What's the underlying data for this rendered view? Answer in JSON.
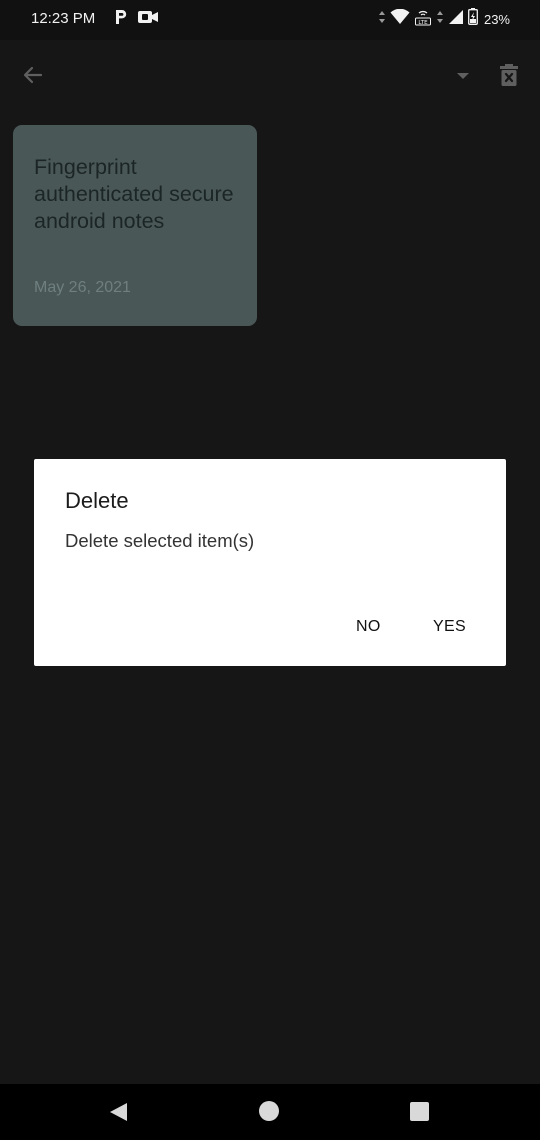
{
  "status_bar": {
    "time": "12:23 PM",
    "left_icons": [
      "parking-p-icon",
      "video-camera-icon"
    ],
    "right_icons": [
      "data-arrows-icon",
      "wifi-icon",
      "volte-icon",
      "signal-icon",
      "battery-charging-icon"
    ],
    "battery_percent": "23%"
  },
  "app_bar": {
    "back_icon": "arrow-left-icon",
    "dropdown_icon": "caret-down-icon",
    "delete_icon": "trash-x-icon"
  },
  "note": {
    "title": "Fingerprint authenticated secure android notes",
    "date": "May 26, 2021",
    "color": "#4a5757"
  },
  "dialog": {
    "title": "Delete",
    "message": "Delete selected item(s)",
    "no_label": "NO",
    "yes_label": "YES"
  },
  "nav_bar": {
    "back": "triangle-back-icon",
    "home": "circle-home-icon",
    "recents": "square-recents-icon"
  }
}
